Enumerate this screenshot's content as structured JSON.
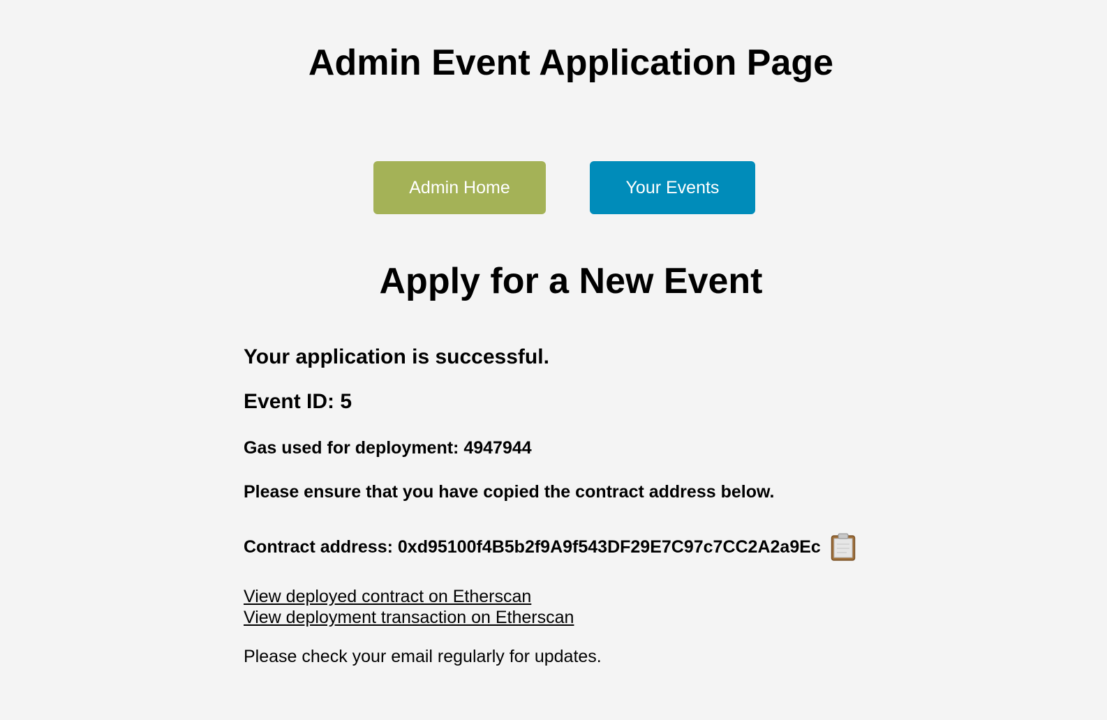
{
  "header": {
    "title": "Admin Event Application Page"
  },
  "nav": {
    "home_label": "Admin Home",
    "events_label": "Your Events"
  },
  "main": {
    "section_title": "Apply for a New Event",
    "success_message": "Your application is successful.",
    "event_id_text": "Event ID: 5",
    "gas_text": "Gas used for deployment: 4947944",
    "ensure_text": "Please ensure that you have copied the contract address below.",
    "contract_text": "Contract address: 0xd95100f4B5b2f9A9f543DF29E7C97c7CC2A2a9Ec",
    "copy_icon": "clipboard-icon",
    "link_contract": "View deployed contract on Etherscan",
    "link_transaction": "View deployment transaction on Etherscan",
    "note": "Please check your email regularly for updates."
  },
  "colors": {
    "background": "#f4f4f4",
    "home_button": "#a4b257",
    "events_button": "#008cba"
  }
}
